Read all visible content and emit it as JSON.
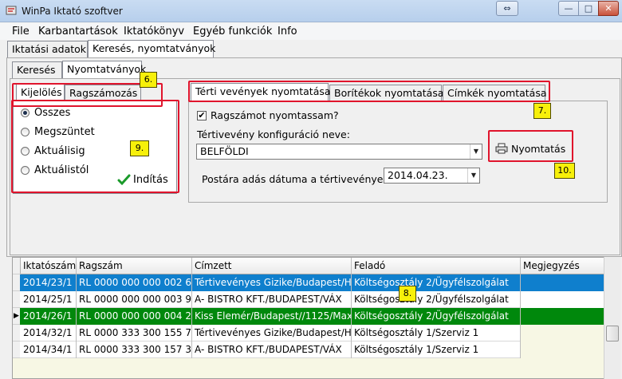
{
  "window": {
    "title": "WinPa Iktató szoftver",
    "restore_glyph": "⇔",
    "minimize_glyph": "—",
    "maximize_glyph": "□",
    "close_glyph": "✕"
  },
  "menu": [
    "File",
    "Karbantartások",
    "Iktatókönyv",
    "Egyéb funkciók",
    "Info"
  ],
  "top_tabs": [
    "Iktatási adatok",
    "Keresés, nyomtatványok"
  ],
  "sub_tabs": [
    "Keresés",
    "Nyomtatványok"
  ],
  "inner_tabs": [
    "Kijelölés",
    "Ragszámozás"
  ],
  "radios": [
    {
      "label": "Összes",
      "checked": true
    },
    {
      "label": "Megszüntet",
      "checked": false
    },
    {
      "label": "Aktuálisig",
      "checked": false
    },
    {
      "label": "Aktuálistól",
      "checked": false
    }
  ],
  "start_button": {
    "label": "Indítás",
    "icon": "checkmark-icon"
  },
  "print_tabs": [
    "Térti vevények nyomtatása",
    "Borítékok nyomtatása",
    "Címkék nyomtatása"
  ],
  "print_form": {
    "checkbox_label": "Ragszámot nyomtassam?",
    "checkbox_checked": true,
    "config_label": "Tértivevény konfiguráció neve:",
    "config_value": "BELFÖLDI",
    "date_label": "Postára adás dátuma a tértivevényen:",
    "date_value": "2014.04.23."
  },
  "print_button": {
    "label": "Nyomtatás",
    "icon": "printer-icon"
  },
  "badges": {
    "b6": "6.",
    "b7": "7.",
    "b8": "8.",
    "b9": "9.",
    "b10": "10."
  },
  "grid": {
    "columns": [
      "Iktatószám",
      "Ragszám",
      "Címzett",
      "Feladó",
      "Megjegyzés"
    ],
    "rows": [
      {
        "style": "selected",
        "current": false,
        "cells": [
          "2014/23/1",
          "RL 0000 000 000 002 6",
          "Tértivevényes Gizike/Budapest/Ház",
          "Költségosztály 2/Ügyfélszolgálat",
          ""
        ]
      },
      {
        "style": "white",
        "current": false,
        "cells": [
          "2014/25/1",
          "RL 0000 000 000 003 9",
          "A- BISTRO KFT./BUDAPEST/VÁX",
          "Költségosztály 2/Ügyfélszolgálat",
          ""
        ]
      },
      {
        "style": "green",
        "current": true,
        "cells": [
          "2014/26/1",
          "RL 0000 000 000 004 2",
          "Kiss Elemér/Budapest//1125/Max",
          "Költségosztály 2/Ügyfélszolgálat",
          ""
        ]
      },
      {
        "style": "white",
        "current": false,
        "cells": [
          "2014/32/1",
          "RL 0000 333 300 155 7",
          "Tértivevényes Gizike/Budapest/Ház",
          "Költségosztály 1/Szerviz 1",
          ""
        ]
      },
      {
        "style": "white",
        "current": false,
        "cells": [
          "2014/34/1",
          "RL 0000 333 300 157 3",
          "A- BISTRO KFT./BUDAPEST/VÁX",
          "Költségosztály 1/Szerviz 1",
          ""
        ]
      }
    ]
  },
  "colors": {
    "selected_row": "#0f7fcd",
    "green_row": "#00880c",
    "highlight_box": "#e0142c",
    "badge": "#f7f00a"
  }
}
